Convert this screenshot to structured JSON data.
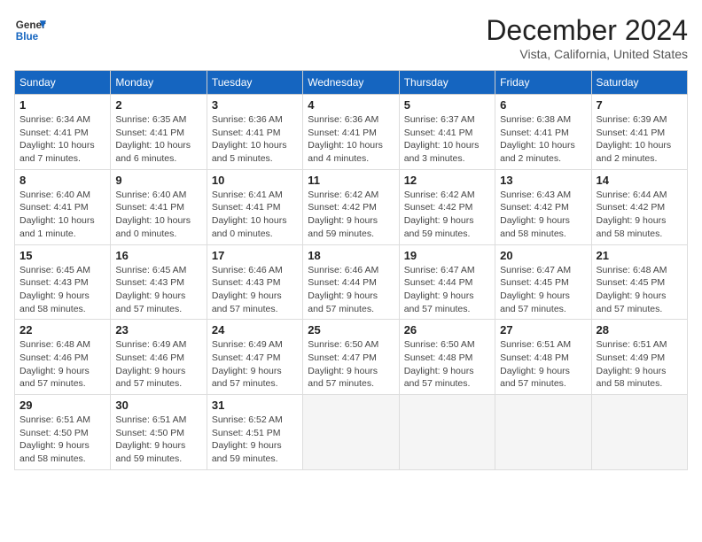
{
  "header": {
    "logo_general": "General",
    "logo_blue": "Blue",
    "month_year": "December 2024",
    "location": "Vista, California, United States"
  },
  "days_of_week": [
    "Sunday",
    "Monday",
    "Tuesday",
    "Wednesday",
    "Thursday",
    "Friday",
    "Saturday"
  ],
  "weeks": [
    [
      {
        "day": 1,
        "sunrise": "6:34 AM",
        "sunset": "4:41 PM",
        "daylight": "10 hours and 7 minutes."
      },
      {
        "day": 2,
        "sunrise": "6:35 AM",
        "sunset": "4:41 PM",
        "daylight": "10 hours and 6 minutes."
      },
      {
        "day": 3,
        "sunrise": "6:36 AM",
        "sunset": "4:41 PM",
        "daylight": "10 hours and 5 minutes."
      },
      {
        "day": 4,
        "sunrise": "6:36 AM",
        "sunset": "4:41 PM",
        "daylight": "10 hours and 4 minutes."
      },
      {
        "day": 5,
        "sunrise": "6:37 AM",
        "sunset": "4:41 PM",
        "daylight": "10 hours and 3 minutes."
      },
      {
        "day": 6,
        "sunrise": "6:38 AM",
        "sunset": "4:41 PM",
        "daylight": "10 hours and 2 minutes."
      },
      {
        "day": 7,
        "sunrise": "6:39 AM",
        "sunset": "4:41 PM",
        "daylight": "10 hours and 2 minutes."
      }
    ],
    [
      {
        "day": 8,
        "sunrise": "6:40 AM",
        "sunset": "4:41 PM",
        "daylight": "10 hours and 1 minute."
      },
      {
        "day": 9,
        "sunrise": "6:40 AM",
        "sunset": "4:41 PM",
        "daylight": "10 hours and 0 minutes."
      },
      {
        "day": 10,
        "sunrise": "6:41 AM",
        "sunset": "4:41 PM",
        "daylight": "10 hours and 0 minutes."
      },
      {
        "day": 11,
        "sunrise": "6:42 AM",
        "sunset": "4:42 PM",
        "daylight": "9 hours and 59 minutes."
      },
      {
        "day": 12,
        "sunrise": "6:42 AM",
        "sunset": "4:42 PM",
        "daylight": "9 hours and 59 minutes."
      },
      {
        "day": 13,
        "sunrise": "6:43 AM",
        "sunset": "4:42 PM",
        "daylight": "9 hours and 58 minutes."
      },
      {
        "day": 14,
        "sunrise": "6:44 AM",
        "sunset": "4:42 PM",
        "daylight": "9 hours and 58 minutes."
      }
    ],
    [
      {
        "day": 15,
        "sunrise": "6:45 AM",
        "sunset": "4:43 PM",
        "daylight": "9 hours and 58 minutes."
      },
      {
        "day": 16,
        "sunrise": "6:45 AM",
        "sunset": "4:43 PM",
        "daylight": "9 hours and 57 minutes."
      },
      {
        "day": 17,
        "sunrise": "6:46 AM",
        "sunset": "4:43 PM",
        "daylight": "9 hours and 57 minutes."
      },
      {
        "day": 18,
        "sunrise": "6:46 AM",
        "sunset": "4:44 PM",
        "daylight": "9 hours and 57 minutes."
      },
      {
        "day": 19,
        "sunrise": "6:47 AM",
        "sunset": "4:44 PM",
        "daylight": "9 hours and 57 minutes."
      },
      {
        "day": 20,
        "sunrise": "6:47 AM",
        "sunset": "4:45 PM",
        "daylight": "9 hours and 57 minutes."
      },
      {
        "day": 21,
        "sunrise": "6:48 AM",
        "sunset": "4:45 PM",
        "daylight": "9 hours and 57 minutes."
      }
    ],
    [
      {
        "day": 22,
        "sunrise": "6:48 AM",
        "sunset": "4:46 PM",
        "daylight": "9 hours and 57 minutes."
      },
      {
        "day": 23,
        "sunrise": "6:49 AM",
        "sunset": "4:46 PM",
        "daylight": "9 hours and 57 minutes."
      },
      {
        "day": 24,
        "sunrise": "6:49 AM",
        "sunset": "4:47 PM",
        "daylight": "9 hours and 57 minutes."
      },
      {
        "day": 25,
        "sunrise": "6:50 AM",
        "sunset": "4:47 PM",
        "daylight": "9 hours and 57 minutes."
      },
      {
        "day": 26,
        "sunrise": "6:50 AM",
        "sunset": "4:48 PM",
        "daylight": "9 hours and 57 minutes."
      },
      {
        "day": 27,
        "sunrise": "6:51 AM",
        "sunset": "4:48 PM",
        "daylight": "9 hours and 57 minutes."
      },
      {
        "day": 28,
        "sunrise": "6:51 AM",
        "sunset": "4:49 PM",
        "daylight": "9 hours and 58 minutes."
      }
    ],
    [
      {
        "day": 29,
        "sunrise": "6:51 AM",
        "sunset": "4:50 PM",
        "daylight": "9 hours and 58 minutes."
      },
      {
        "day": 30,
        "sunrise": "6:51 AM",
        "sunset": "4:50 PM",
        "daylight": "9 hours and 59 minutes."
      },
      {
        "day": 31,
        "sunrise": "6:52 AM",
        "sunset": "4:51 PM",
        "daylight": "9 hours and 59 minutes."
      },
      null,
      null,
      null,
      null
    ]
  ]
}
